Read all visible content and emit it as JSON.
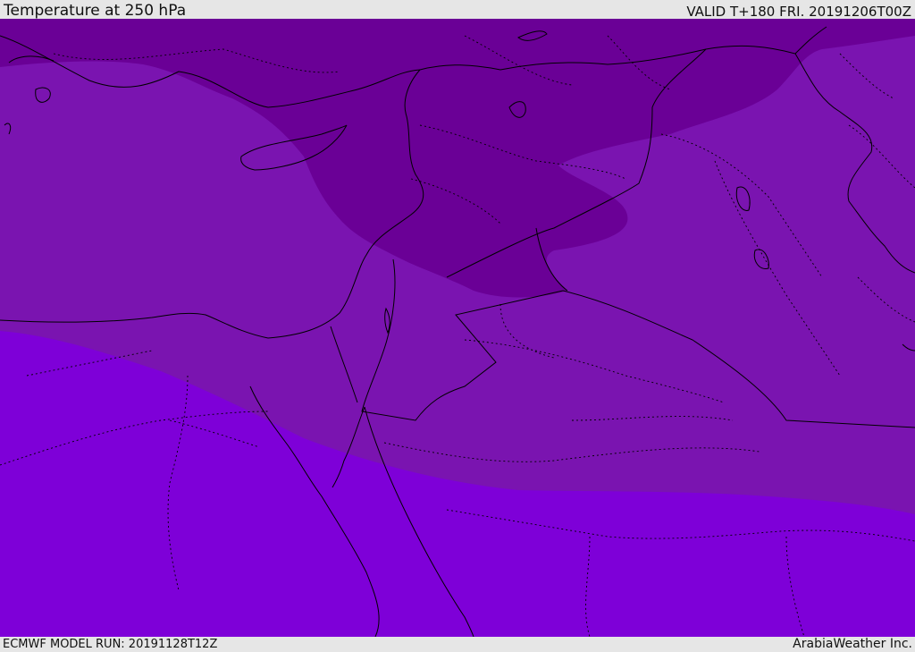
{
  "header": {
    "title": "Temperature at 250 hPa",
    "valid": "VALID T+180 FRI. 20191206T00Z"
  },
  "footer": {
    "model_run": "ECMWF MODEL RUN: 20191128T12Z",
    "credit": "ArabiaWeather Inc."
  },
  "map": {
    "colors": {
      "coldest_band": "#6a0096",
      "middle_band": "#7a14b0",
      "warmest_band": "#7e00d8",
      "boundary": "#000000"
    }
  }
}
